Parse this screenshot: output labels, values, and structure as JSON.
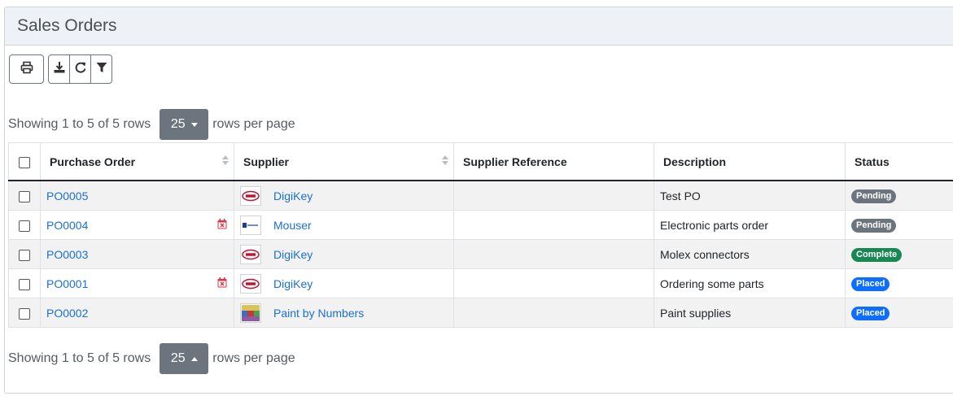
{
  "page": {
    "title": "Sales Orders"
  },
  "toolbar": {
    "print_icon": "print-icon",
    "download_icon": "download-icon",
    "refresh_icon": "refresh-icon",
    "filter_icon": "filter-icon"
  },
  "pagination": {
    "summary": "Showing 1 to 5 of 5 rows",
    "page_size": "25",
    "per_page_label": "rows per page"
  },
  "table": {
    "columns": [
      "Purchase Order",
      "Supplier",
      "Supplier Reference",
      "Description",
      "Status"
    ],
    "rows": [
      {
        "po": "PO0005",
        "overdue": false,
        "supplier": "DigiKey",
        "supplier_logo": "digikey-logo",
        "reference": "",
        "description": "Test PO",
        "status": "Pending",
        "status_color": "#6c757d"
      },
      {
        "po": "PO0004",
        "overdue": true,
        "supplier": "Mouser",
        "supplier_logo": "mouser-logo",
        "reference": "",
        "description": "Electronic parts order",
        "status": "Pending",
        "status_color": "#6c757d"
      },
      {
        "po": "PO0003",
        "overdue": false,
        "supplier": "DigiKey",
        "supplier_logo": "digikey-logo",
        "reference": "",
        "description": "Molex connectors",
        "status": "Complete",
        "status_color": "#198754"
      },
      {
        "po": "PO0001",
        "overdue": true,
        "supplier": "DigiKey",
        "supplier_logo": "digikey-logo",
        "reference": "",
        "description": "Ordering some parts",
        "status": "Placed",
        "status_color": "#0d6efd"
      },
      {
        "po": "PO0002",
        "overdue": false,
        "supplier": "Paint by Numbers",
        "supplier_logo": "paint-logo",
        "reference": "",
        "description": "Paint supplies",
        "status": "Placed",
        "status_color": "#0d6efd"
      }
    ]
  },
  "colors": {
    "link": "#1a6fd4",
    "overdue_icon": "#dc3545",
    "header_bg": "#eef2f6"
  }
}
